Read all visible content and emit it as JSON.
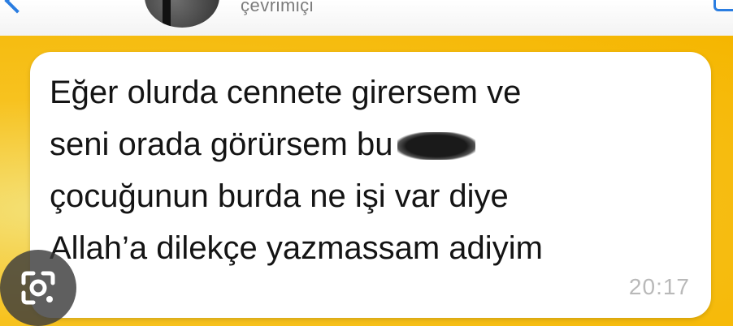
{
  "header": {
    "status": "çevrimiçi",
    "back_icon": "chevron-left-icon",
    "menu_icon": "menu-icon"
  },
  "message": {
    "lines": [
      "Eğer olurda cennete girersem ve",
      "seni orada görürsem bu",
      "çocuğunun burda ne işi var diye",
      "Allah’a dilekçe yazmassam adiyim"
    ],
    "time": "20:17"
  },
  "overlay": {
    "lens_icon": "google-lens-icon"
  },
  "colors": {
    "wallpaper": "#f7c21f",
    "bubble": "#ffffff",
    "header_accent": "#2a7de1"
  }
}
